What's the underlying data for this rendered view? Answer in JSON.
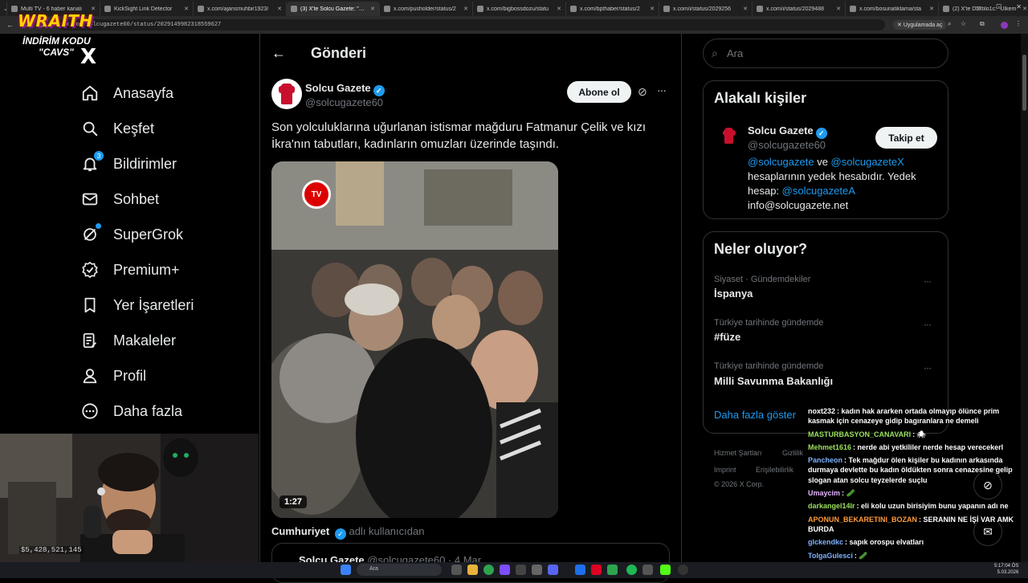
{
  "browser": {
    "tabs": [
      {
        "label": "Multi TV - 6 haber kanalı",
        "active": false
      },
      {
        "label": "KickSight Link Detector",
        "active": false
      },
      {
        "label": "x.com/ajansmuhbir1923/",
        "active": false
      },
      {
        "label": "(3) X'te Solcu Gazete: \"Son",
        "active": true
      },
      {
        "label": "x.com/pusholder/status/2",
        "active": false
      },
      {
        "label": "x.com/bigbossdozu/statu",
        "active": false
      },
      {
        "label": "x.com/bpthaber/status/2",
        "active": false
      },
      {
        "label": "x.com/i/status/2029256",
        "active": false
      },
      {
        "label": "x.com/i/status/2029488",
        "active": false
      },
      {
        "label": "x.com/bosunatiklama/sta",
        "active": false
      },
      {
        "label": "(2) X'te Daktilo1c: \"Ülkem",
        "active": false
      }
    ],
    "url": "x.com/solcugazete60/status/2029149982318559627",
    "translate_label": "Uygulamada aç",
    "new_tab": "+"
  },
  "overlay": {
    "brand": "WRAITH",
    "promo_line1": "İNDİRİM KODU",
    "promo_line2": "\"CAVS\"",
    "money": "$5,428,521,145"
  },
  "sidebar": {
    "logo": "X",
    "items": [
      {
        "label": "Anasayfa",
        "icon": "home-icon"
      },
      {
        "label": "Keşfet",
        "icon": "search-icon"
      },
      {
        "label": "Bildirimler",
        "icon": "bell-icon",
        "badge": "3"
      },
      {
        "label": "Sohbet",
        "icon": "mail-icon"
      },
      {
        "label": "SuperGrok",
        "icon": "grok-icon"
      },
      {
        "label": "Premium+",
        "icon": "verified-badge-icon"
      },
      {
        "label": "Yer İşaretleri",
        "icon": "bookmark-icon"
      },
      {
        "label": "Makaleler",
        "icon": "article-icon"
      },
      {
        "label": "Profil",
        "icon": "profile-icon"
      },
      {
        "label": "Daha fazla",
        "icon": "more-circle-icon"
      }
    ]
  },
  "post": {
    "header_title": "Gönderi",
    "author_name": "Solcu Gazete",
    "author_handle": "@solcugazete60",
    "subscribe_label": "Abone ol",
    "text": "Son yolculuklarına uğurlanan istismar mağduru Fatmanur Çelik ve kızı İkra'nın tabutları, kadınların omuzları üzerinde taşındı.",
    "video_duration": "1:27",
    "video_logo": "TV",
    "credit_name": "Cumhuriyet",
    "credit_suffix": "adlı kullanıcıdan",
    "quote_name": "Solcu Gazete",
    "quote_handle": "@solcugazete60 · 4 Mar"
  },
  "right": {
    "search_placeholder": "Ara",
    "related_title": "Alakalı kişiler",
    "related": {
      "name": "Solcu Gazete",
      "handle": "@solcugazete60",
      "follow_label": "Takip et",
      "bio_link1": "@solcugazete",
      "bio_and": " ve ",
      "bio_link2": "@solcugazeteX",
      "bio_mid": " hesaplarının yedek hesabıdır. Yedek hesap: ",
      "bio_link3": "@solcugazeteA",
      "bio_end": "info@solcugazete.net"
    },
    "trends_title": "Neler oluyor?",
    "trends": [
      {
        "meta": "Siyaset · Gündemdekiler",
        "name": "İspanya"
      },
      {
        "meta": "Türkiye tarihinde gündemde",
        "name": "#füze"
      },
      {
        "meta": "Türkiye tarihinde gündemde",
        "name": "Milli Savunma Bakanlığı"
      }
    ],
    "show_more": "Daha fazla göster",
    "footer": {
      "terms": "Hizmet Şartları",
      "privacy": "Gizlilik",
      "imprint": "Imprint",
      "accessibility": "Erişilebilirlik",
      "copyright": "© 2026 X Corp."
    }
  },
  "chat": [
    {
      "user": "noxt232",
      "color": "#ffffff",
      "text": ": kadın hak ararken ortada olmayıp ölünce prim kasmak için cenazeye gidip bagıranlara ne demeli"
    },
    {
      "user": "MASTURBASYON_CANAVARI",
      "color": "#9be15d",
      "text": ": 🕷"
    },
    {
      "user": "Mehmet1616",
      "color": "#9be15d",
      "text": ": nerde abi yetkililer nerde hesap verecekerl"
    },
    {
      "user": "Pancheon",
      "color": "#7fb2ff",
      "text": ": Tek mağdur ölen kişiler bu kadının arkasında durmaya devlette bu kadın öldükten sonra cenazesine gelip slogan atan solcu teyzelerde suçlu"
    },
    {
      "user": "Umaycim",
      "color": "#e4b5ff",
      "text": ": 🥒"
    },
    {
      "user": "darkangel14lr",
      "color": "#9be15d",
      "text": ": eli kolu uzun birisiyim bunu yapanın adı ne"
    },
    {
      "user": "APONUN_BEKARETINI_BOZAN",
      "color": "#ff9b3d",
      "text": ": SERANIN NE İŞİ VAR AMK BURDA"
    },
    {
      "user": "glckendkc",
      "color": "#7fb2ff",
      "text": ": sapık orospu elvatları"
    },
    {
      "user": "TolgaGulesci",
      "color": "#7fb2ff",
      "text": ": 🥒"
    }
  ],
  "taskbar": {
    "search_placeholder": "Ara",
    "time": "5:17:04 ÖS",
    "date": "5.03.2026"
  },
  "colors": {
    "accent": "#1d9bf0",
    "background": "#000000",
    "border": "#2f3336",
    "muted": "#71767b"
  }
}
